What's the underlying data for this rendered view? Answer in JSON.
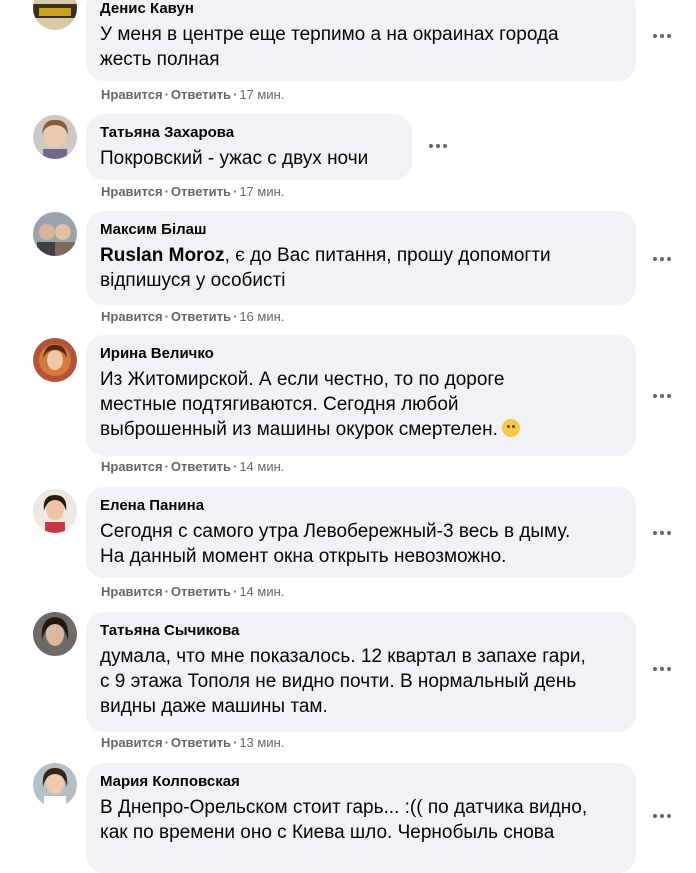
{
  "actions": {
    "like": "Нравится",
    "reply": "Ответить",
    "separator": "·"
  },
  "comments": [
    {
      "author": "Денис Кавун",
      "lines": [
        "У меня в центре еще терпимо а на окраинах города",
        "жесть полная"
      ],
      "time": "17 мин."
    },
    {
      "author": "Татьяна Захарова",
      "lines": [
        "Покровский - ужас с двух ночи"
      ],
      "time": "17 мин."
    },
    {
      "author": "Максим Білаш",
      "mention": "Ruslan Moroz",
      "lines": [
        ", є до Вас питання, прошу допомогти",
        "відпишуся у особисті"
      ],
      "time": "16 мин."
    },
    {
      "author": "Ирина Величко",
      "lines": [
        "Из Житомирской. А если честно, то по дороге",
        "местные подтягиваются. Сегодня любой",
        "выброшенный из машины окурок смертелен."
      ],
      "emoji": "sad-face-emoji",
      "time": "14 мин."
    },
    {
      "author": "Елена Панина",
      "lines": [
        "Сегодня с самого утра Левобережный-3 весь в дыму.",
        "На данный момент окна открыть невозможно."
      ],
      "time": "14 мин."
    },
    {
      "author": "Татьяна Сычикова",
      "lines": [
        "думала, что мне показалось. 12 квартал в запахе гари,",
        "с 9 этажа Тополя не видно почти. В нормальный день",
        "видны даже машины там."
      ],
      "time": "13 мин."
    },
    {
      "author": "Мария Колповская",
      "lines": [
        "В Днепро-Орельском стоит гарь... :(( по датчика видно,",
        "как по времени оно с Киева шло. Чернобыль снова"
      ]
    }
  ]
}
